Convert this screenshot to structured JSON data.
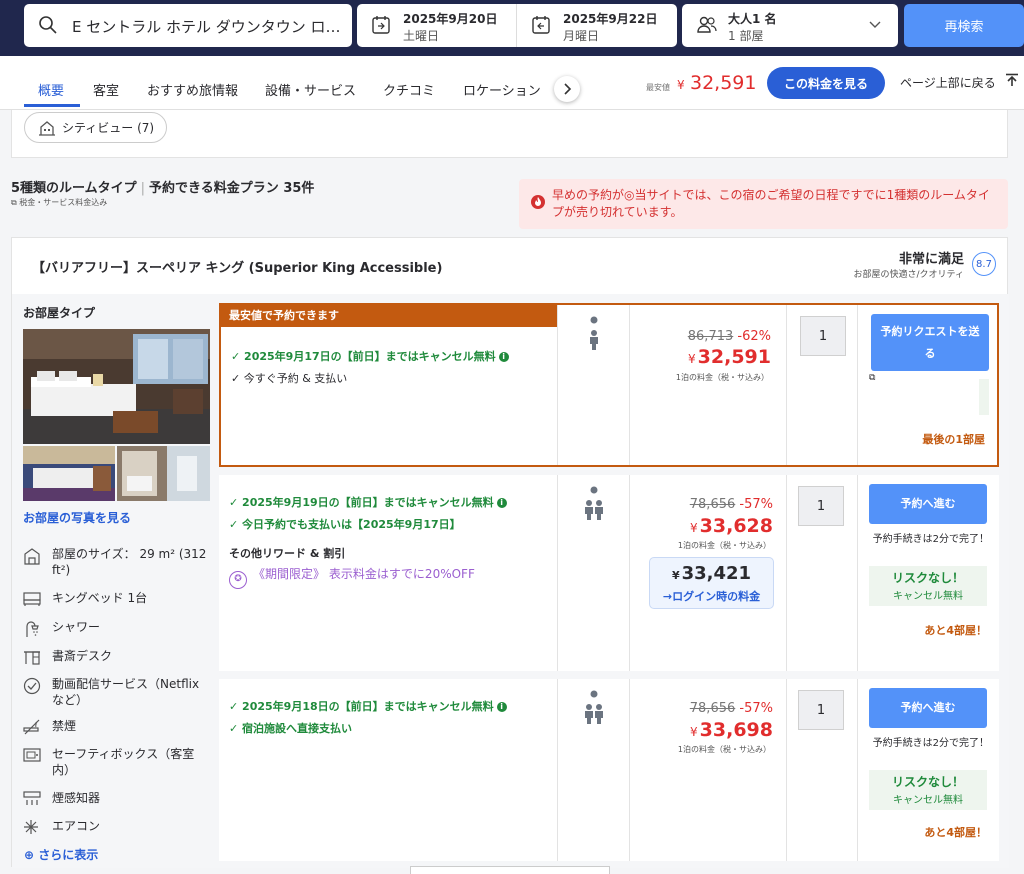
{
  "search": {
    "destination": "E セントラル ホテル ダウンタウン ロ…"
  },
  "dates": {
    "checkin": {
      "date": "2025年9月20日",
      "day": "土曜日"
    },
    "checkout": {
      "date": "2025年9月22日",
      "day": "月曜日"
    }
  },
  "guests": {
    "adults": "大人1 名",
    "rooms": "1 部屋"
  },
  "research_label": "再検索",
  "nav": {
    "tabs": [
      "概要",
      "客室",
      "おすすめ旅情報",
      "設備・サービス",
      "クチコミ",
      "ロケーション"
    ],
    "lowest_label": "最安値",
    "lowest_currency": "¥",
    "lowest_price": "32,591",
    "see_price": "この料金を見る",
    "back_to_top": "ページ上部に戻る"
  },
  "cityview": "シティビュー (7)",
  "summary": {
    "room_types": "5種類のルームタイプ",
    "plans": "予約できる料金プラン 35件",
    "tax_note": "税金・サービス料金込み"
  },
  "alert": "早めの予約が◎当サイトでは、この宿のご希望の日程ですでに1種類のルームタイプが売り切れています。",
  "room": {
    "title": "【バリアフリー】スーペリア キング (Superior King Accessible)",
    "rating_label": "非常に満足",
    "rating_sub": "お部屋の快適さ/クオリティ",
    "rating_score": "8.7",
    "room_type_label": "お部屋タイプ",
    "see_photos": "お部屋の写真を見る",
    "amenities": [
      "部屋のサイズ： 29 m² (312 ft²)",
      "キングベッド 1台",
      "シャワー",
      "書斎デスク",
      "動画配信サービス（Netflix など）",
      "禁煙",
      "セーフティボックス（客室内）",
      "煙感知器",
      "エアコン"
    ],
    "show_more": "さらに表示"
  },
  "offers": [
    {
      "banner": "最安値で予約できます",
      "cond1": "2025年9月17日の【前日】まではキャンセル無料",
      "cond2": "今すぐ予約 & 支払い",
      "original": "86,713",
      "discount": "-62%",
      "currency": "¥",
      "price": "32,591",
      "per_night": "1泊の料金（税・サ込み）",
      "qty": "1",
      "button": "予約リクエストを送る",
      "rooms_left": "最後の1部屋"
    },
    {
      "cond1": "2025年9月19日の【前日】まではキャンセル無料",
      "cond2": "今日予約でも支払いは【2025年9月17日】",
      "other_rewards": "その他リワード & 割引",
      "promo": "《期間限定》 表示料金はすでに20%OFF",
      "original": "78,656",
      "discount": "-57%",
      "currency": "¥",
      "price": "33,628",
      "per_night": "1泊の料金（税・サ込み）",
      "login_price": "33,421",
      "login_label": "→ログイン時の料金",
      "qty": "1",
      "button": "予約へ進む",
      "process": "予約手続きは2分で完了！",
      "no_risk": "リスクなし！",
      "free_cancel": "キャンセル無料",
      "rooms_left": "あと4部屋！"
    },
    {
      "cond1": "2025年9月18日の【前日】まではキャンセル無料",
      "cond2": "宿泊施設へ直接支払い",
      "original": "78,656",
      "discount": "-57%",
      "currency": "¥",
      "price": "33,698",
      "per_night": "1泊の料金（税・サ込み）",
      "qty": "1",
      "button": "予約へ進む",
      "process": "予約手続きは2分で完了！",
      "no_risk": "リスクなし！",
      "free_cancel": "キャンセル無料",
      "rooms_left": "あと4部屋！"
    }
  ],
  "colors": {
    "navy": "#20274d",
    "accent": "#5392f9",
    "link": "#2a5fd6",
    "price": "#e12d2d",
    "green": "#1f8a3b",
    "orange": "#c35a10"
  }
}
